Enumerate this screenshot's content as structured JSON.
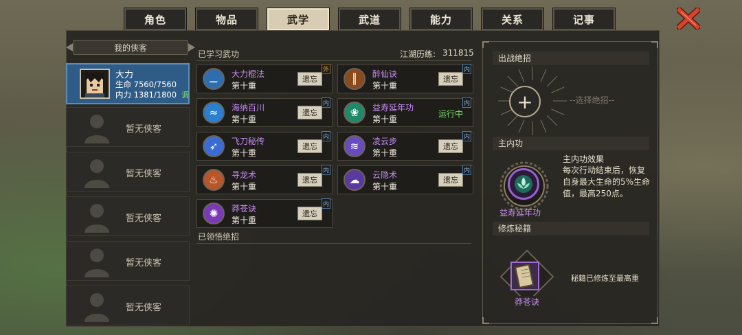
{
  "tabs": [
    {
      "label": "角色",
      "active": false
    },
    {
      "label": "物品",
      "active": false
    },
    {
      "label": "武学",
      "active": true
    },
    {
      "label": "武道",
      "active": false
    },
    {
      "label": "能力",
      "active": false
    },
    {
      "label": "关系",
      "active": false
    },
    {
      "label": "记事",
      "active": false
    }
  ],
  "close_icon": "close-x-icon",
  "roster": {
    "title": "我的侠客",
    "hero": {
      "name": "大力",
      "hp": "生命 7560/7560",
      "mp": "内力 1381/1800",
      "adjust": "调"
    },
    "empty_label": "暂无侠客",
    "empty_slots": [
      "暂无侠客",
      "暂无侠客",
      "暂无侠客",
      "暂无侠客",
      "暂无侠客"
    ]
  },
  "learned": {
    "title": "已学习武功",
    "exp_label": "江湖历练:",
    "exp_value": "311815",
    "skills": [
      {
        "name": "大力棍法",
        "level": "第十重",
        "action": "遗忘",
        "tag": "外",
        "icon": "staff-icon",
        "color": "#2d6db0"
      },
      {
        "name": "醉仙诀",
        "level": "第十重",
        "action": "遗忘",
        "tag": "内",
        "icon": "bamboo-icon",
        "color": "#8a4a1c"
      },
      {
        "name": "海纳百川",
        "level": "第十重",
        "action": "遗忘",
        "tag": "内",
        "icon": "wave-icon",
        "color": "#2a7fd0"
      },
      {
        "name": "益寿延年功",
        "level": "第十重",
        "action": "运行中",
        "tag": "内",
        "icon": "lotus-icon",
        "color": "#1f8a6a"
      },
      {
        "name": "飞刀秘传",
        "level": "第十重",
        "action": "遗忘",
        "tag": "内",
        "icon": "dagger-icon",
        "color": "#3a6cd6"
      },
      {
        "name": "凌云步",
        "level": "第十重",
        "action": "遗忘",
        "tag": "内",
        "icon": "feather-icon",
        "color": "#6a4ac0"
      },
      {
        "name": "寻龙术",
        "level": "第十重",
        "action": "遗忘",
        "tag": "内",
        "icon": "flame-icon",
        "color": "#b8562a"
      },
      {
        "name": "云隐术",
        "level": "第十重",
        "action": "遗忘",
        "tag": "内",
        "icon": "cloud-mask-icon",
        "color": "#5a3aa0"
      },
      {
        "name": "莽苍诀",
        "level": "第十重",
        "action": "遗忘",
        "tag": "内",
        "icon": "starburst-icon",
        "color": "#7a3ab8"
      }
    ]
  },
  "comprehended": {
    "title": "已领悟绝招"
  },
  "right": {
    "ultimate_title": "出战绝招",
    "select_hint": "--选择绝招--",
    "main_title": "主内功",
    "main_name": "益寿延年功",
    "effect_title": "主内功效果",
    "effect_desc": "每次行动结束后，恢复自身最大生命的5%生命值，最高250点。",
    "cultivate_title": "修炼秘籍",
    "book_name": "莽苍诀",
    "book_status": "秘籍已修炼至最高重"
  }
}
